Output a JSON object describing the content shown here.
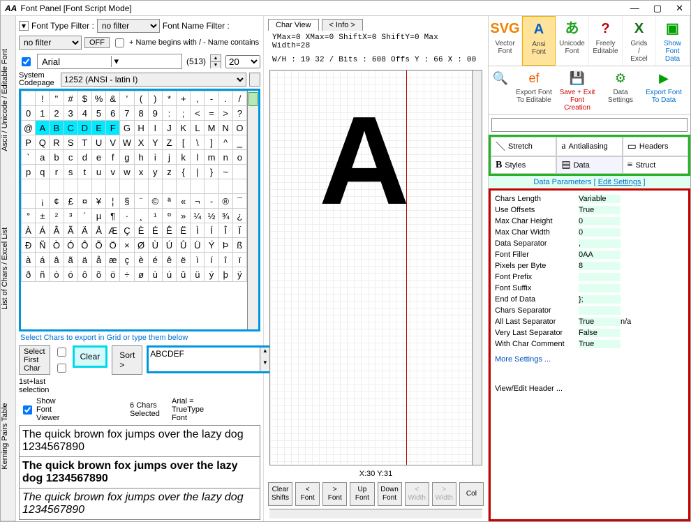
{
  "title": "Font Panel [Font Script Mode]",
  "win_controls": {
    "min": "—",
    "max": "▢",
    "close": "✕"
  },
  "side_tabs": [
    "Ascii / Unicode / Editable Font",
    "List of Chars / Excel List",
    "Kerning Pairs Table"
  ],
  "filters": {
    "type_label": "Font Type Filter :",
    "type_value": "no filter",
    "name_label": "Font Name Filter :",
    "name_value": "no filter",
    "off": "OFF",
    "plusminus": "+ Name begins with / - Name contains"
  },
  "font_row": {
    "font_name": "Arial",
    "count": "(513)",
    "size": "20"
  },
  "codepage": {
    "label": "System Codepage",
    "value": "1252  (ANSI - latin I)"
  },
  "char_grid_rows": [
    [
      " ",
      "!",
      "\"",
      "#",
      "$",
      "%",
      "&",
      "'",
      "(",
      ")",
      "*",
      "+",
      ",",
      "-",
      ".",
      "/"
    ],
    [
      "0",
      "1",
      "2",
      "3",
      "4",
      "5",
      "6",
      "7",
      "8",
      "9",
      ":",
      ";",
      "<",
      "=",
      ">",
      "?"
    ],
    [
      "@",
      "A",
      "B",
      "C",
      "D",
      "E",
      "F",
      "G",
      "H",
      "I",
      "J",
      "K",
      "L",
      "M",
      "N",
      "O"
    ],
    [
      "P",
      "Q",
      "R",
      "S",
      "T",
      "U",
      "V",
      "W",
      "X",
      "Y",
      "Z",
      "[",
      "\\",
      "]",
      "^",
      "_"
    ],
    [
      "`",
      "a",
      "b",
      "c",
      "d",
      "e",
      "f",
      "g",
      "h",
      "i",
      "j",
      "k",
      "l",
      "m",
      "n",
      "o"
    ],
    [
      "p",
      "q",
      "r",
      "s",
      "t",
      "u",
      "v",
      "w",
      "x",
      "y",
      "z",
      "{",
      "|",
      "}",
      "~",
      ""
    ],
    [
      "",
      "",
      "",
      "",
      "",
      "",
      "",
      "",
      "",
      "",
      "",
      "",
      "",
      "",
      "",
      ""
    ],
    [
      "",
      "¡",
      "¢",
      "£",
      "¤",
      "¥",
      "¦",
      "§",
      "¨",
      "©",
      "ª",
      "«",
      "¬",
      "-",
      "®",
      "¯"
    ],
    [
      "°",
      "±",
      "²",
      "³",
      "´",
      "µ",
      "¶",
      "·",
      "¸",
      "¹",
      "º",
      "»",
      "¼",
      "½",
      "¾",
      "¿"
    ],
    [
      "À",
      "Á",
      "Â",
      "Ã",
      "Ä",
      "Å",
      "Æ",
      "Ç",
      "È",
      "É",
      "Ê",
      "Ë",
      "Ì",
      "Í",
      "Î",
      "Ï"
    ],
    [
      "Ð",
      "Ñ",
      "Ò",
      "Ó",
      "Ô",
      "Õ",
      "Ö",
      "×",
      "Ø",
      "Ù",
      "Ú",
      "Û",
      "Ü",
      "Ý",
      "Þ",
      "ß"
    ],
    [
      "à",
      "á",
      "â",
      "ã",
      "ä",
      "å",
      "æ",
      "ç",
      "è",
      "é",
      "ê",
      "ë",
      "ì",
      "í",
      "î",
      "ï"
    ],
    [
      "ð",
      "ñ",
      "ò",
      "ó",
      "ô",
      "õ",
      "ö",
      "÷",
      "ø",
      "ù",
      "ú",
      "û",
      "ü",
      "ý",
      "þ",
      "ÿ"
    ]
  ],
  "selected_cells": [
    [
      2,
      1
    ],
    [
      2,
      2
    ],
    [
      2,
      3
    ],
    [
      2,
      4
    ],
    [
      2,
      5
    ],
    [
      2,
      6
    ]
  ],
  "select_note": "Select Chars to export in Grid or type them below",
  "sel": {
    "first_btn": "Select First Char",
    "firstlast": "1st+last selection",
    "clear": "Clear",
    "sort": "Sort >",
    "text": "ABCDEF"
  },
  "status": {
    "show_viewer": "Show Font Viewer",
    "chars_selected": "6 Chars Selected",
    "font_type": "Arial = TrueType Font"
  },
  "preview_lines": [
    "The quick brown fox jumps over the lazy dog 1234567890",
    "The quick brown fox jumps over the lazy dog 1234567890",
    "The quick brown fox jumps over the lazy dog 1234567890"
  ],
  "charview": {
    "tab1": "Char View",
    "tab2": "< Info >",
    "meta1": "YMax=0  XMax=0  ShiftX=0  ShiftY=0  Max Width=28",
    "meta2": "W/H : 19  32 / Bits : 608  Offs  Y : 66  X : 00",
    "coords": "X:30 Y:31",
    "buttons": [
      {
        "l1": "Clear",
        "l2": "Shifts"
      },
      {
        "l1": "<",
        "l2": "Font"
      },
      {
        "l1": ">",
        "l2": "Font"
      },
      {
        "l1": "Up",
        "l2": "Font"
      },
      {
        "l1": "Down",
        "l2": "Font"
      },
      {
        "l1": "<",
        "l2": "Width",
        "dis": true
      },
      {
        "l1": ">",
        "l2": "Width",
        "dis": true
      },
      {
        "l1": "Col",
        "l2": ""
      }
    ],
    "glyph": "A"
  },
  "ribbon": [
    {
      "label": "Vector Font",
      "icon": "SVG",
      "color": "#f08000"
    },
    {
      "label": "Ansi Font",
      "icon": "A",
      "color": "#0060d0",
      "active": true
    },
    {
      "label": "Unicode Font",
      "icon": "あ",
      "color": "#20a020"
    },
    {
      "label": "Freely Editable",
      "icon": "?",
      "color": "#c00000"
    },
    {
      "label": "Grids / Excel",
      "icon": "X",
      "color": "#107010"
    },
    {
      "label": "Show Font Data",
      "icon": "▣",
      "color": "#00a000",
      "textcolor": "#0070d0"
    }
  ],
  "ribbon2": [
    {
      "label": "",
      "icon": "🔍"
    },
    {
      "label": "Export Font To Editable",
      "icon": "ef",
      "color": "#f06000"
    },
    {
      "label": "Save + Exit Font Creation",
      "icon": "💾",
      "color": "#d00000",
      "textcolor": "#d00000"
    },
    {
      "label": "Data Settings",
      "icon": "⚙",
      "color": "#109010"
    },
    {
      "label": "Export Font To Data",
      "icon": "▶",
      "color": "#00a000",
      "textcolor": "#0070d0"
    }
  ],
  "param_tabs": [
    {
      "icon": "＼",
      "label": "Stretch"
    },
    {
      "icon": "a",
      "label": "Antialiasing"
    },
    {
      "icon": "▭",
      "label": "Headers"
    },
    {
      "icon": "B",
      "label": "Styles",
      "bold": true
    },
    {
      "icon": "▤",
      "label": "Data",
      "cur": true
    },
    {
      "icon": "≡",
      "label": "Struct"
    }
  ],
  "param_head": {
    "pre": "Data Parameters [ ",
    "link": "Edit Settings",
    "post": " ]"
  },
  "params": [
    {
      "k": "Chars Length",
      "v": "Variable"
    },
    {
      "k": "Use Offsets",
      "v": "True"
    },
    {
      "k": "Max Char Height",
      "v": "0"
    },
    {
      "k": "Max Char Width",
      "v": "0"
    },
    {
      "k": "Data Separator",
      "v": ","
    },
    {
      "k": "Font Filler",
      "v": "0AA"
    },
    {
      "k": "Pixels per Byte",
      "v": "8"
    },
    {
      "k": "Font Prefix",
      "v": ""
    },
    {
      "k": "Font Suffix",
      "v": ""
    },
    {
      "k": "End of Data",
      "v": "};"
    },
    {
      "k": "Chars Separator",
      "v": ""
    },
    {
      "k": "All Last Separator",
      "v": "True",
      "x": "n/a"
    },
    {
      "k": "Very Last Separator",
      "v": "False"
    },
    {
      "k": "With Char Comment",
      "v": "True"
    }
  ],
  "more": "More Settings ...",
  "viewedit": "View/Edit Header ..."
}
